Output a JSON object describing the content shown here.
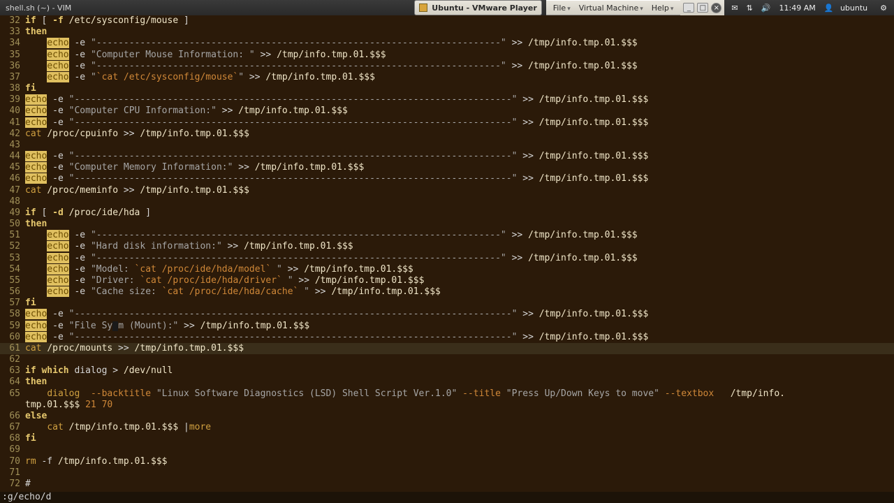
{
  "topbar": {
    "title": "shell.sh (~) - VIM",
    "task_label": "Ubuntu - VMware Player",
    "menus": [
      "File",
      "Virtual Machine",
      "Help"
    ],
    "time": "11:49 AM",
    "user": "ubuntu"
  },
  "cursor_line": 61,
  "first_line": 32,
  "lines": [
    {
      "n": 32,
      "seg": [
        [
          "kw",
          "if"
        ],
        [
          "txt",
          " [ "
        ],
        [
          "kw",
          "-f"
        ],
        [
          "txt",
          " "
        ],
        [
          "pth",
          "/etc/sysconfig/mouse"
        ],
        [
          "txt",
          " ]"
        ]
      ]
    },
    {
      "n": 33,
      "seg": [
        [
          "kw",
          "then"
        ]
      ]
    },
    {
      "n": 34,
      "seg": [
        [
          "txt",
          "    "
        ],
        [
          "hl",
          "echo"
        ],
        [
          "txt",
          " "
        ],
        [
          "opt",
          "-e"
        ],
        [
          "txt",
          " "
        ],
        [
          "str",
          "\"--------------------------------------------------------------------------\""
        ],
        [
          "txt",
          " >> "
        ],
        [
          "pth",
          "/tmp/info.tmp.01.$$$"
        ]
      ]
    },
    {
      "n": 35,
      "seg": [
        [
          "txt",
          "    "
        ],
        [
          "hl",
          "echo"
        ],
        [
          "txt",
          " "
        ],
        [
          "opt",
          "-e"
        ],
        [
          "txt",
          " "
        ],
        [
          "str",
          "\"Computer Mouse Information: \""
        ],
        [
          "txt",
          " >> "
        ],
        [
          "pth",
          "/tmp/info.tmp.01.$$$"
        ]
      ]
    },
    {
      "n": 36,
      "seg": [
        [
          "txt",
          "    "
        ],
        [
          "hl",
          "echo"
        ],
        [
          "txt",
          " "
        ],
        [
          "opt",
          "-e"
        ],
        [
          "txt",
          " "
        ],
        [
          "str",
          "\"--------------------------------------------------------------------------\""
        ],
        [
          "txt",
          " >> "
        ],
        [
          "pth",
          "/tmp/info.tmp.01.$$$"
        ]
      ]
    },
    {
      "n": 37,
      "seg": [
        [
          "txt",
          "    "
        ],
        [
          "hl",
          "echo"
        ],
        [
          "txt",
          " "
        ],
        [
          "opt",
          "-e"
        ],
        [
          "txt",
          " "
        ],
        [
          "str",
          "\""
        ],
        [
          "sub",
          "`cat /etc/sysconfig/mouse`"
        ],
        [
          "str",
          "\""
        ],
        [
          "txt",
          " >> "
        ],
        [
          "pth",
          "/tmp/info.tmp.01.$$$"
        ]
      ]
    },
    {
      "n": 38,
      "seg": [
        [
          "kw",
          "fi"
        ]
      ]
    },
    {
      "n": 39,
      "seg": [
        [
          "hl",
          "echo"
        ],
        [
          "txt",
          " "
        ],
        [
          "opt",
          "-e"
        ],
        [
          "txt",
          " "
        ],
        [
          "str",
          "\"--------------------------------------------------------------------------------\""
        ],
        [
          "txt",
          " >> "
        ],
        [
          "pth",
          "/tmp/info.tmp.01.$$$"
        ]
      ]
    },
    {
      "n": 40,
      "seg": [
        [
          "hl",
          "echo"
        ],
        [
          "txt",
          " "
        ],
        [
          "opt",
          "-e"
        ],
        [
          "txt",
          " "
        ],
        [
          "str",
          "\"Computer CPU Information:\""
        ],
        [
          "txt",
          " >> "
        ],
        [
          "pth",
          "/tmp/info.tmp.01.$$$"
        ]
      ]
    },
    {
      "n": 41,
      "seg": [
        [
          "hl",
          "echo"
        ],
        [
          "txt",
          " "
        ],
        [
          "opt",
          "-e"
        ],
        [
          "txt",
          " "
        ],
        [
          "str",
          "\"--------------------------------------------------------------------------------\""
        ],
        [
          "txt",
          " >> "
        ],
        [
          "pth",
          "/tmp/info.tmp.01.$$$"
        ]
      ]
    },
    {
      "n": 42,
      "seg": [
        [
          "cmd",
          "cat"
        ],
        [
          "txt",
          " "
        ],
        [
          "pth",
          "/proc/cpuinfo"
        ],
        [
          "txt",
          " >> "
        ],
        [
          "pth",
          "/tmp/info.tmp.01.$$$"
        ]
      ]
    },
    {
      "n": 43,
      "seg": []
    },
    {
      "n": 44,
      "seg": [
        [
          "hl",
          "echo"
        ],
        [
          "txt",
          " "
        ],
        [
          "opt",
          "-e"
        ],
        [
          "txt",
          " "
        ],
        [
          "str",
          "\"--------------------------------------------------------------------------------\""
        ],
        [
          "txt",
          " >> "
        ],
        [
          "pth",
          "/tmp/info.tmp.01.$$$"
        ]
      ]
    },
    {
      "n": 45,
      "seg": [
        [
          "hl",
          "echo"
        ],
        [
          "txt",
          " "
        ],
        [
          "opt",
          "-e"
        ],
        [
          "txt",
          " "
        ],
        [
          "str",
          "\"Computer Memory Information:\""
        ],
        [
          "txt",
          " >> "
        ],
        [
          "pth",
          "/tmp/info.tmp.01.$$$"
        ]
      ]
    },
    {
      "n": 46,
      "seg": [
        [
          "hl",
          "echo"
        ],
        [
          "txt",
          " "
        ],
        [
          "opt",
          "-e"
        ],
        [
          "txt",
          " "
        ],
        [
          "str",
          "\"--------------------------------------------------------------------------------\""
        ],
        [
          "txt",
          " >> "
        ],
        [
          "pth",
          "/tmp/info.tmp.01.$$$"
        ]
      ]
    },
    {
      "n": 47,
      "seg": [
        [
          "cmd",
          "cat"
        ],
        [
          "txt",
          " "
        ],
        [
          "pth",
          "/proc/meminfo"
        ],
        [
          "txt",
          " >> "
        ],
        [
          "pth",
          "/tmp/info.tmp.01.$$$"
        ]
      ]
    },
    {
      "n": 48,
      "seg": []
    },
    {
      "n": 49,
      "seg": [
        [
          "kw",
          "if"
        ],
        [
          "txt",
          " [ "
        ],
        [
          "kw",
          "-d"
        ],
        [
          "txt",
          " "
        ],
        [
          "pth",
          "/proc/ide/hda"
        ],
        [
          "txt",
          " ]"
        ]
      ]
    },
    {
      "n": 50,
      "seg": [
        [
          "kw",
          "then"
        ]
      ]
    },
    {
      "n": 51,
      "seg": [
        [
          "txt",
          "    "
        ],
        [
          "hl",
          "echo"
        ],
        [
          "txt",
          " "
        ],
        [
          "opt",
          "-e"
        ],
        [
          "txt",
          " "
        ],
        [
          "str",
          "\"--------------------------------------------------------------------------\""
        ],
        [
          "txt",
          " >> "
        ],
        [
          "pth",
          "/tmp/info.tmp.01.$$$"
        ]
      ]
    },
    {
      "n": 52,
      "seg": [
        [
          "txt",
          "    "
        ],
        [
          "hl",
          "echo"
        ],
        [
          "txt",
          " "
        ],
        [
          "opt",
          "-e"
        ],
        [
          "txt",
          " "
        ],
        [
          "str",
          "\"Hard disk information:\""
        ],
        [
          "txt",
          " >> "
        ],
        [
          "pth",
          "/tmp/info.tmp.01.$$$"
        ]
      ]
    },
    {
      "n": 53,
      "seg": [
        [
          "txt",
          "    "
        ],
        [
          "hl",
          "echo"
        ],
        [
          "txt",
          " "
        ],
        [
          "opt",
          "-e"
        ],
        [
          "txt",
          " "
        ],
        [
          "str",
          "\"--------------------------------------------------------------------------\""
        ],
        [
          "txt",
          " >> "
        ],
        [
          "pth",
          "/tmp/info.tmp.01.$$$"
        ]
      ]
    },
    {
      "n": 54,
      "seg": [
        [
          "txt",
          "    "
        ],
        [
          "hl",
          "echo"
        ],
        [
          "txt",
          " "
        ],
        [
          "opt",
          "-e"
        ],
        [
          "txt",
          " "
        ],
        [
          "str",
          "\"Model: "
        ],
        [
          "sub",
          "`cat /proc/ide/hda/model`"
        ],
        [
          "str",
          " \""
        ],
        [
          "txt",
          " >> "
        ],
        [
          "pth",
          "/tmp/info.tmp.01.$$$"
        ]
      ]
    },
    {
      "n": 55,
      "seg": [
        [
          "txt",
          "    "
        ],
        [
          "hl",
          "echo"
        ],
        [
          "txt",
          " "
        ],
        [
          "opt",
          "-e"
        ],
        [
          "txt",
          " "
        ],
        [
          "str",
          "\"Driver: "
        ],
        [
          "sub",
          "`cat /proc/ide/hda/driver`"
        ],
        [
          "str",
          " \""
        ],
        [
          "txt",
          " >> "
        ],
        [
          "pth",
          "/tmp/info.tmp.01.$$$"
        ]
      ]
    },
    {
      "n": 56,
      "seg": [
        [
          "txt",
          "    "
        ],
        [
          "hl",
          "echo"
        ],
        [
          "txt",
          " "
        ],
        [
          "opt",
          "-e"
        ],
        [
          "txt",
          " "
        ],
        [
          "str",
          "\"Cache size: "
        ],
        [
          "sub",
          "`cat /proc/ide/hda/cache`"
        ],
        [
          "str",
          " \""
        ],
        [
          "txt",
          " >> "
        ],
        [
          "pth",
          "/tmp/info.tmp.01.$$$"
        ]
      ]
    },
    {
      "n": 57,
      "seg": [
        [
          "kw",
          "fi"
        ]
      ]
    },
    {
      "n": 58,
      "seg": [
        [
          "hl",
          "echo"
        ],
        [
          "txt",
          " "
        ],
        [
          "opt",
          "-e"
        ],
        [
          "txt",
          " "
        ],
        [
          "str",
          "\"--------------------------------------------------------------------------------\""
        ],
        [
          "txt",
          " >> "
        ],
        [
          "pth",
          "/tmp/info.tmp.01.$$$"
        ]
      ]
    },
    {
      "n": 59,
      "seg": [
        [
          "hl",
          "echo"
        ],
        [
          "txt",
          " "
        ],
        [
          "opt",
          "-e"
        ],
        [
          "txt",
          " "
        ],
        [
          "str",
          "\"File Sy"
        ],
        [
          "cursor",
          ""
        ],
        [
          "str",
          "m (Mount):\""
        ],
        [
          "txt",
          " >> "
        ],
        [
          "pth",
          "/tmp/info.tmp.01.$$$"
        ]
      ]
    },
    {
      "n": 60,
      "seg": [
        [
          "hl",
          "echo"
        ],
        [
          "txt",
          " "
        ],
        [
          "opt",
          "-e"
        ],
        [
          "txt",
          " "
        ],
        [
          "str",
          "\"--------------------------------------------------------------------------------\""
        ],
        [
          "txt",
          " >> "
        ],
        [
          "pth",
          "/tmp/info.tmp.01.$$$"
        ]
      ]
    },
    {
      "n": 61,
      "seg": [
        [
          "cmd",
          "cat"
        ],
        [
          "txt",
          " "
        ],
        [
          "pth",
          "/proc/mounts"
        ],
        [
          "txt",
          " >> "
        ],
        [
          "pth",
          "/tmp/info.tmp.01.$$$"
        ]
      ]
    },
    {
      "n": 62,
      "seg": []
    },
    {
      "n": 63,
      "seg": [
        [
          "kw",
          "if"
        ],
        [
          "txt",
          " "
        ],
        [
          "kw",
          "which"
        ],
        [
          "txt",
          " dialog > "
        ],
        [
          "pth",
          "/dev/null"
        ]
      ]
    },
    {
      "n": 64,
      "seg": [
        [
          "kw",
          "then"
        ]
      ]
    },
    {
      "n": 65,
      "seg": [
        [
          "txt",
          "    "
        ],
        [
          "cmd",
          "dialog"
        ],
        [
          "txt",
          "  "
        ],
        [
          "flag",
          "--backtitle"
        ],
        [
          "txt",
          " "
        ],
        [
          "str",
          "\"Linux Software Diagnostics (LSD) Shell Script Ver.1.0\""
        ],
        [
          "txt",
          " "
        ],
        [
          "flag",
          "--title"
        ],
        [
          "txt",
          " "
        ],
        [
          "str",
          "\"Press Up/Down Keys to move\""
        ],
        [
          "txt",
          " "
        ],
        [
          "flag",
          "--textbox"
        ],
        [
          "txt",
          "   "
        ],
        [
          "pth",
          "/tmp/info."
        ]
      ]
    },
    {
      "n": 0,
      "wrap": true,
      "seg": [
        [
          "pth",
          "tmp.01.$$$"
        ],
        [
          "txt",
          " "
        ],
        [
          "num",
          "21 70"
        ]
      ]
    },
    {
      "n": 66,
      "seg": [
        [
          "kw",
          "else"
        ]
      ]
    },
    {
      "n": 67,
      "seg": [
        [
          "txt",
          "    "
        ],
        [
          "cmd",
          "cat"
        ],
        [
          "txt",
          " "
        ],
        [
          "pth",
          "/tmp/info.tmp.01.$$$"
        ],
        [
          "txt",
          " |"
        ],
        [
          "cmd",
          "more"
        ]
      ]
    },
    {
      "n": 68,
      "seg": [
        [
          "kw",
          "fi"
        ]
      ]
    },
    {
      "n": 69,
      "seg": []
    },
    {
      "n": 70,
      "seg": [
        [
          "cmd",
          "rm"
        ],
        [
          "txt",
          " "
        ],
        [
          "opt",
          "-f"
        ],
        [
          "txt",
          " "
        ],
        [
          "pth",
          "/tmp/info.tmp.01.$$$"
        ]
      ]
    },
    {
      "n": 71,
      "seg": []
    },
    {
      "n": 72,
      "seg": [
        [
          "txt",
          "#"
        ]
      ]
    }
  ],
  "cmdline": ":g/echo/d"
}
